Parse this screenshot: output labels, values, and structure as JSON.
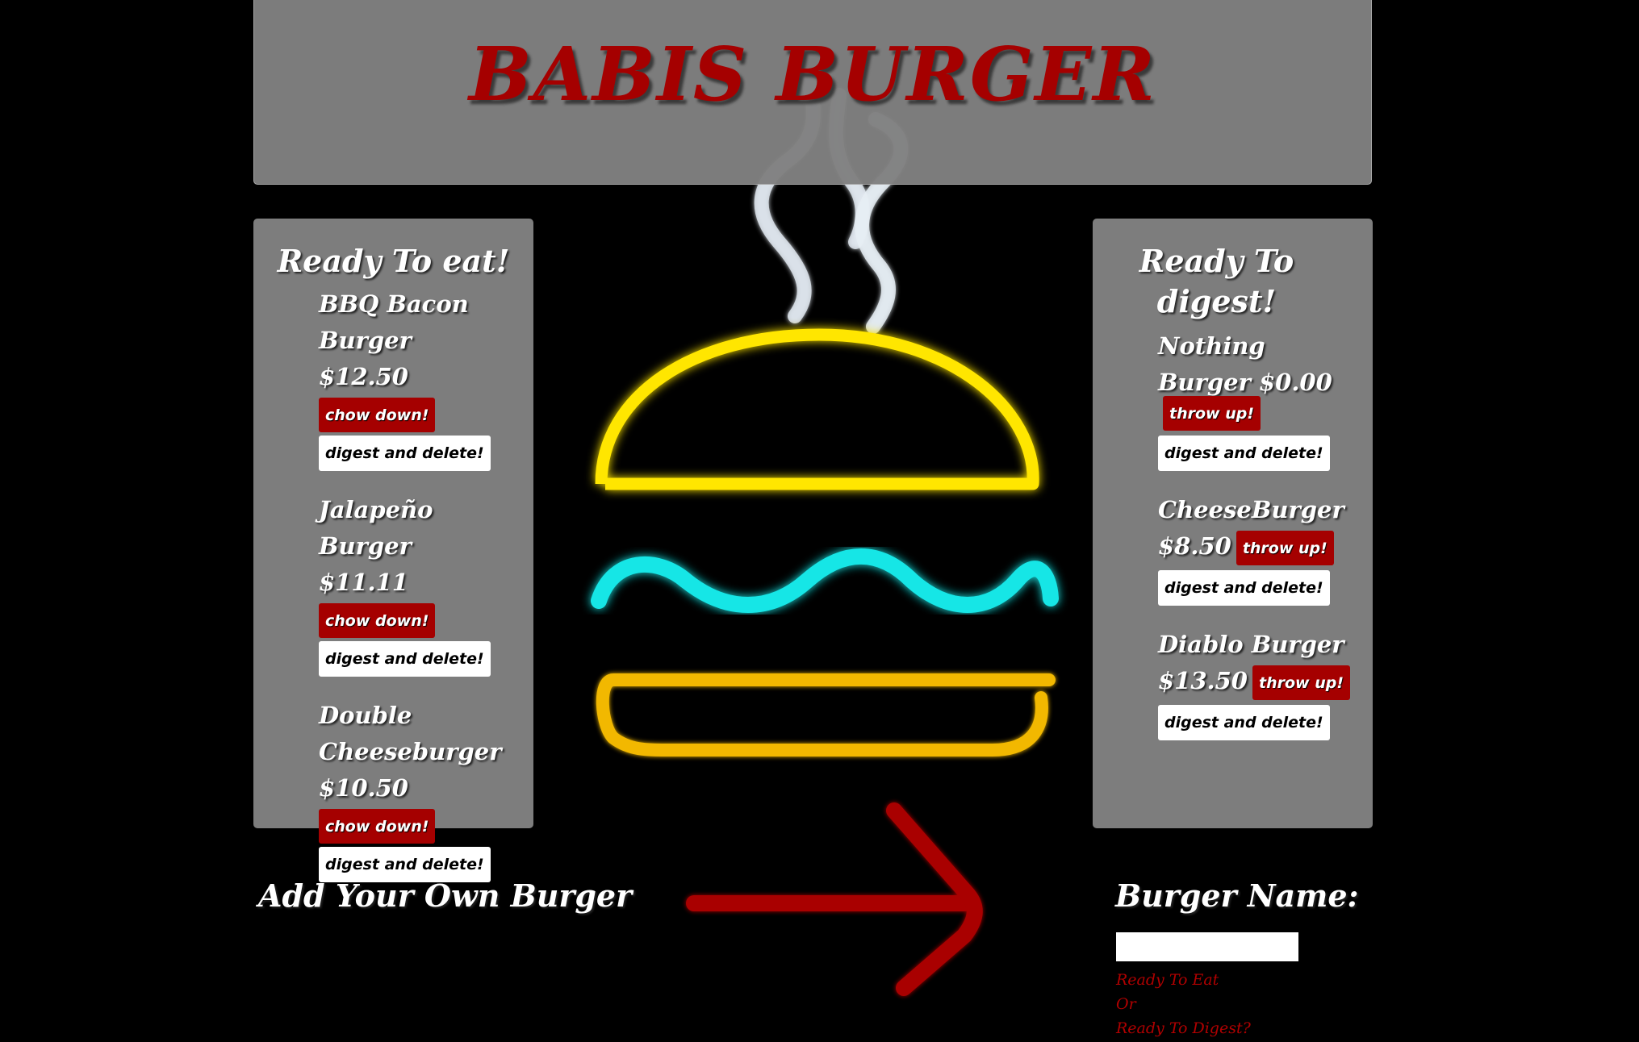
{
  "app": {
    "title": "BABIS BURGER"
  },
  "ready_to_eat": {
    "heading": "Ready To eat!",
    "items": [
      {
        "text": "BBQ Bacon Burger $12.50",
        "primary_label": "chow down!",
        "secondary_label": "digest and delete!"
      },
      {
        "text": "Jalapeño Burger $11.11",
        "primary_label": "chow down!",
        "secondary_label": "digest and delete!"
      },
      {
        "text": "Double Cheeseburger $10.50",
        "primary_label": "chow down!",
        "secondary_label": "digest and delete!"
      }
    ]
  },
  "ready_to_digest": {
    "heading": "Ready To digest!",
    "items": [
      {
        "text": "Nothing Burger $0.00",
        "primary_label": "throw up!",
        "secondary_label": "digest and delete!"
      },
      {
        "text": "CheeseBurger $8.50",
        "primary_label": "throw up!",
        "secondary_label": "digest and delete!"
      },
      {
        "text": "Diablo Burger $13.50",
        "primary_label": "throw up!",
        "secondary_label": "digest and delete!"
      }
    ]
  },
  "add_form": {
    "heading": "Add Your Own Burger",
    "name_label": "Burger Name:",
    "name_value": "",
    "option_eat": "Ready To Eat",
    "option_or": "Or",
    "option_digest": "Ready To Digest?"
  },
  "colors": {
    "accent_red": "#a50000",
    "panel_gray": "#808080",
    "neon_yellow": "#ffe600",
    "neon_red": "#ff1a00",
    "neon_cyan": "#17e6e6",
    "neon_white": "#e6eef5"
  },
  "icons": {
    "background_art": "neon-burger-icon",
    "arrow": "neon-arrow-icon",
    "steam": "steam-icon"
  }
}
